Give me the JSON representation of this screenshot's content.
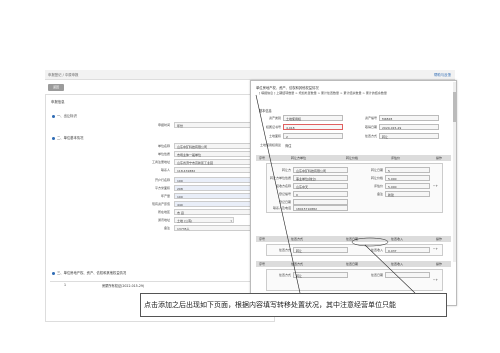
{
  "breadcrumb": "申报登记 / 中原申报",
  "help_link": "帮助与反馈",
  "back_button": "返回",
  "left_panel": {
    "title": "申报信息",
    "section1": "一、出让标识",
    "section2": "二、单位基本情况",
    "fields": [
      {
        "label": "申报时间",
        "value": "年份"
      },
      {
        "label": "单位名称",
        "value": "山东中矿科技有限公司"
      },
      {
        "label": "单位性质",
        "value": "市场主体一般单位"
      },
      {
        "label": "工商注册地址",
        "value": "山东省济宁市高新区工业园"
      },
      {
        "label": "联系人",
        "value": "118.431882"
      },
      {
        "label": "开户行名称",
        "value": "100"
      },
      {
        "label": "平方米面积",
        "value": "208"
      },
      {
        "label": "年产量",
        "value": "100"
      },
      {
        "label": "现有资产原值",
        "value": "440"
      },
      {
        "label": "所在地区",
        "value": "市 县"
      },
      {
        "label": "通讯地址",
        "value": "土地 (公有)"
      },
      {
        "label": "备注",
        "value": "13735人"
      }
    ],
    "section3": "三、单位房地产权、资产、债权和其他权益情况",
    "footer_row": {
      "index": "1",
      "text": "房屋所有权证(2022-015-29)"
    }
  },
  "dialog": {
    "header": "单位房地产权、资产、债权和其他权益情况",
    "steps": "[ 填报信息 ] 上期结转数量 > 增加处置数量 > 累计处置数量 > 累计结余数量 > 累计的结余数量",
    "sub_title": "基本信息",
    "rows": [
      {
        "l1": "资产类别",
        "v1": "土地使用权",
        "l2": "资产编号",
        "v2": "M4828"
      },
      {
        "l1": "权属证书号",
        "v1": "4.018",
        "l2": "取得日期",
        "v2": "2020-015-29"
      },
      {
        "l1": "土地面积",
        "v1": "2",
        "l2": "处置方式",
        "v2": "转让"
      },
      {
        "l1": "土地使用权用途",
        "v1": "商住"
      }
    ],
    "table1_head": [
      "序号",
      "转让方单位",
      "转让价格",
      "评估价",
      "操作"
    ],
    "sub_rows": [
      {
        "l1": "转让方",
        "v1": "山东中矿科技有限公司",
        "l2": "转让日期",
        "v2": "5"
      },
      {
        "l1": "转让方单位性质",
        "v1": "事业单位(独立)",
        "l2": "转让价格",
        "v2": "5.000"
      },
      {
        "l1": "接收方名称",
        "v1": "山东中天",
        "l2": "评估价",
        "v2": "5.000"
      },
      {
        "l1": "登记编号",
        "v1": "0",
        "l2": "备注",
        "v2": "新建"
      },
      {
        "l1": "登记日期",
        "v1": "",
        "l2": "",
        "v2": ""
      },
      {
        "l1": "联系人及电话",
        "v1": "18015710882",
        "l2": "",
        "v2": ""
      }
    ],
    "table2_head": [
      "序号",
      "处置方式",
      "处置日期",
      "处置收入",
      "操作"
    ],
    "table2_row": {
      "l1": "处置方式",
      "v1": "转让",
      "l2": "处置收入",
      "v2": "0.037"
    },
    "table3_head": [
      "序号",
      "处置方式",
      "处置日期",
      "处置收入",
      "操作"
    ],
    "table3_row": {
      "l1": "处置方式",
      "v1": "转让",
      "l2": "处置日期",
      "v2": ""
    }
  },
  "caption": "点击添加之后出现如下页面，根据内容填写转移处置状况，其中注意经营单位只能"
}
